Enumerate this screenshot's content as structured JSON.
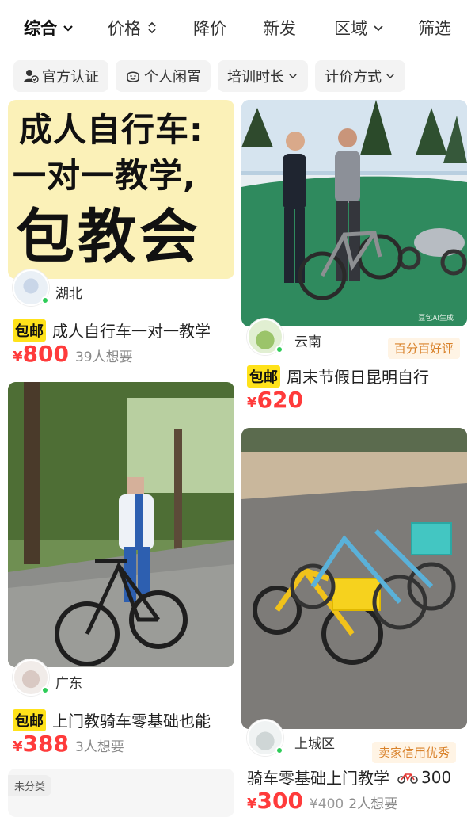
{
  "sort_bar": {
    "items": [
      {
        "label": "综合",
        "has_dropdown": true,
        "active": true
      },
      {
        "label": "价格",
        "has_sort": true
      },
      {
        "label": "降价"
      },
      {
        "label": "新发"
      },
      {
        "label": "区域",
        "has_dropdown": true
      },
      {
        "label": "筛选"
      }
    ]
  },
  "chips": [
    {
      "label": "官方认证",
      "icon": "person-verified-icon"
    },
    {
      "label": "个人闲置",
      "icon": "smile-face-icon"
    },
    {
      "label": "培训时长",
      "icon": "chevron-down-icon"
    },
    {
      "label": "计价方式",
      "icon": "chevron-down-icon"
    }
  ],
  "cards": [
    {
      "poster_lines": [
        "成人自行车:",
        "一对一教学,",
        "包教会"
      ],
      "region": "湖北",
      "baoyou": "包邮",
      "title": "成人自行车一对一教学",
      "currency": "¥",
      "price": "800",
      "want": "39人想要"
    },
    {
      "region": "云南",
      "badge": "百分百好评",
      "baoyou": "包邮",
      "title": "周末节假日昆明自行",
      "currency": "¥",
      "price": "620",
      "watermark": "豆包AI生成"
    },
    {
      "region": "广东",
      "baoyou": "包邮",
      "title": "上门教骑车零基础也能",
      "currency": "¥",
      "price": "388",
      "want": "3人想要"
    },
    {
      "region": "上城区",
      "badge": "卖家信用优秀",
      "title": "骑车零基础上门教学",
      "title_suffix": "300",
      "currency": "¥",
      "price": "300",
      "original_price": "¥400",
      "want": "2人想要"
    }
  ],
  "partial_tag": "未分类",
  "colors": {
    "price": "#ff3b3b",
    "baoyou": "#ffe21a",
    "badge_text": "#d9822b",
    "badge_bg": "#fff4e5"
  }
}
